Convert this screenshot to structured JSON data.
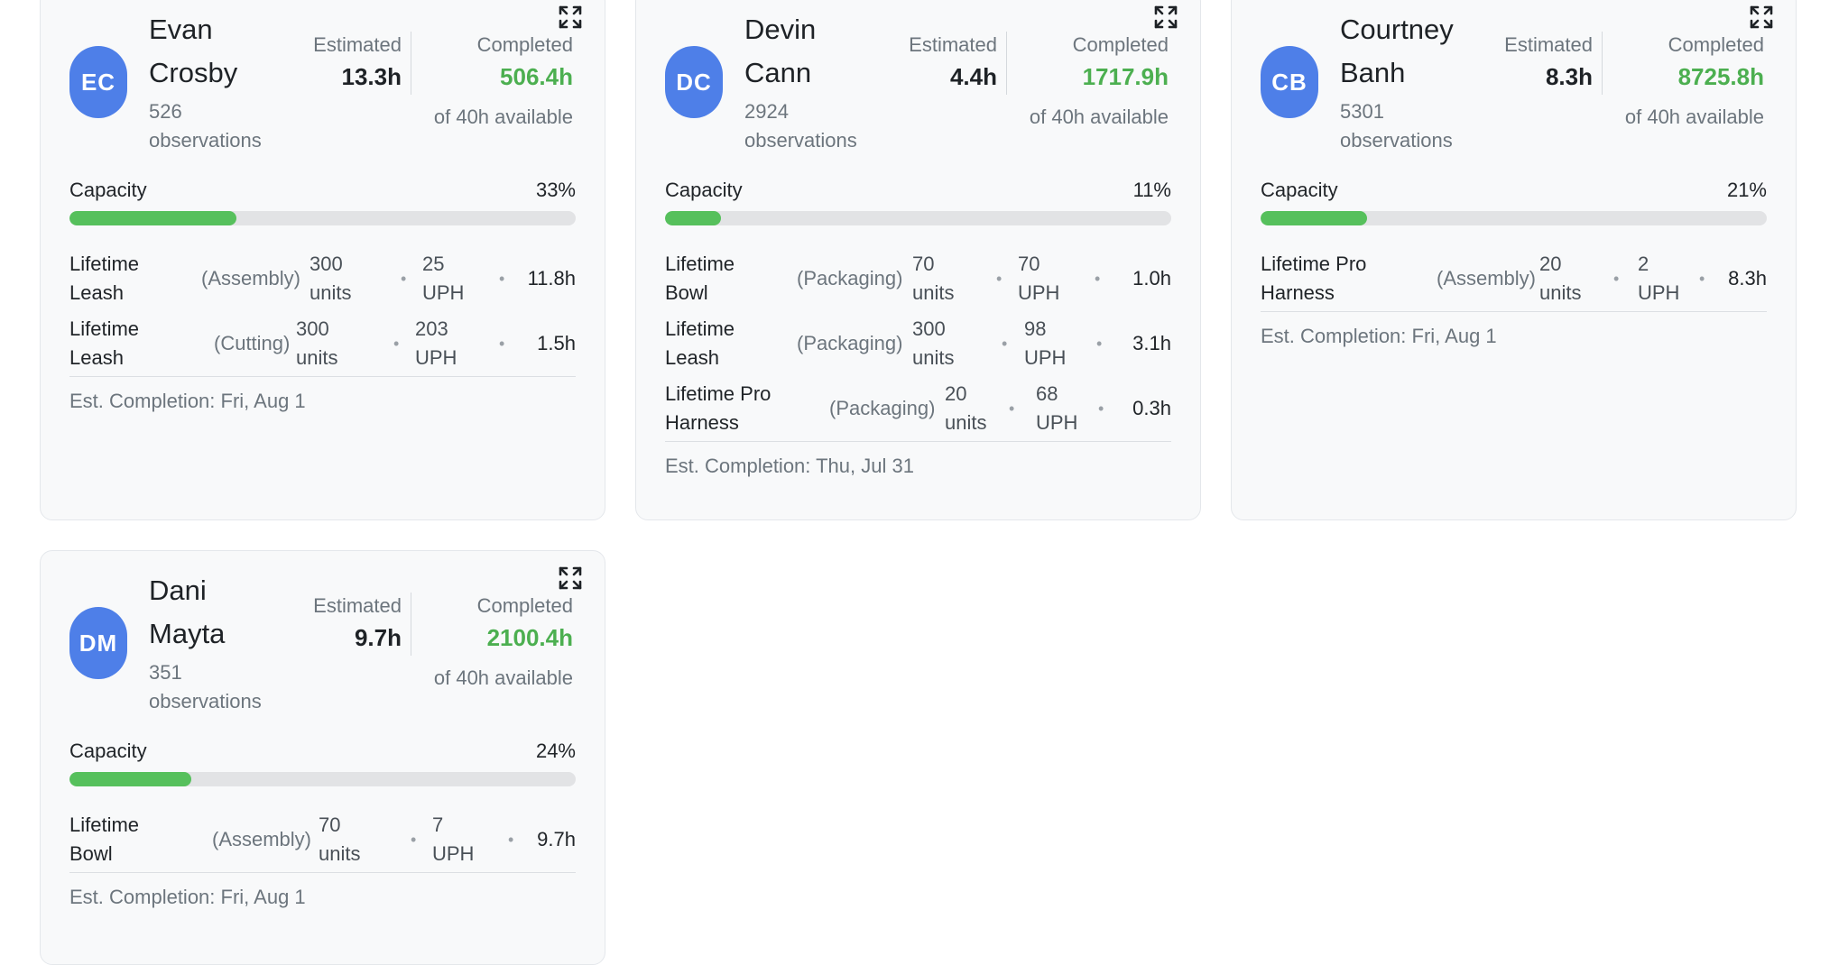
{
  "ui": {
    "estimated_label": "Estimated",
    "completed_label": "Completed",
    "capacity_label": "Capacity",
    "dot": "•"
  },
  "colors": {
    "avatar": "#4e7fe8",
    "completed": "#4caf50",
    "progress_fill": "#56c05c",
    "progress_track": "#e2e3e5"
  },
  "icons": {
    "expand": "expand-arrows-icon"
  },
  "cards": [
    {
      "initials": "EC",
      "first_name": "Evan",
      "last_name": "Crosby",
      "observations_count": "526",
      "observations_word": "observations",
      "estimated": "13.3h",
      "completed": "506.4h",
      "available": "of 40h available",
      "capacity_pct_text": "33%",
      "capacity_fraction": 0.33,
      "tasks": [
        {
          "name_1": "Lifetime",
          "name_2": "Leash",
          "category": "(Assembly)",
          "units_1": "300",
          "units_2": "units",
          "uph_1": "25",
          "uph_2": "UPH",
          "hours": "11.8h"
        },
        {
          "name_1": "Lifetime",
          "name_2": "Leash",
          "category": "(Cutting)",
          "units_1": "300",
          "units_2": "units",
          "uph_1": "203",
          "uph_2": "UPH",
          "hours": "1.5h"
        }
      ],
      "completion": "Est. Completion: Fri, Aug 1"
    },
    {
      "initials": "DC",
      "first_name": "Devin",
      "last_name": "Cann",
      "observations_count": "2924",
      "observations_word": "observations",
      "estimated": "4.4h",
      "completed": "1717.9h",
      "available": "of 40h available",
      "capacity_pct_text": "11%",
      "capacity_fraction": 0.11,
      "tasks": [
        {
          "name_1": "Lifetime",
          "name_2": "Bowl",
          "category": "(Packaging)",
          "units_1": "70",
          "units_2": "units",
          "uph_1": "70",
          "uph_2": "UPH",
          "hours": "1.0h"
        },
        {
          "name_1": "Lifetime",
          "name_2": "Leash",
          "category": "(Packaging)",
          "units_1": "300",
          "units_2": "units",
          "uph_1": "98",
          "uph_2": "UPH",
          "hours": "3.1h"
        },
        {
          "name_1": "Lifetime Pro",
          "name_2": "Harness",
          "category": "(Packaging)",
          "units_1": "20",
          "units_2": "units",
          "uph_1": "68",
          "uph_2": "UPH",
          "hours": "0.3h"
        }
      ],
      "completion": "Est. Completion: Thu, Jul 31"
    },
    {
      "initials": "CB",
      "first_name": "Courtney",
      "last_name": "Banh",
      "observations_count": "5301",
      "observations_word": "observations",
      "estimated": "8.3h",
      "completed": "8725.8h",
      "available": "of 40h available",
      "capacity_pct_text": "21%",
      "capacity_fraction": 0.21,
      "tasks": [
        {
          "name_1": "Lifetime Pro",
          "name_2": "Harness",
          "category": "(Assembly)",
          "units_1": "20",
          "units_2": "units",
          "uph_1": "2",
          "uph_2": "UPH",
          "hours": "8.3h"
        }
      ],
      "completion": "Est. Completion: Fri, Aug 1"
    },
    {
      "initials": "DM",
      "first_name": "Dani",
      "last_name": "Mayta",
      "observations_count": "351",
      "observations_word": "observations",
      "estimated": "9.7h",
      "completed": "2100.4h",
      "available": "of 40h available",
      "capacity_pct_text": "24%",
      "capacity_fraction": 0.24,
      "tasks": [
        {
          "name_1": "Lifetime",
          "name_2": "Bowl",
          "category": "(Assembly)",
          "units_1": "70",
          "units_2": "units",
          "uph_1": "7",
          "uph_2": "UPH",
          "hours": "9.7h"
        }
      ],
      "completion": "Est. Completion: Fri, Aug 1"
    }
  ]
}
